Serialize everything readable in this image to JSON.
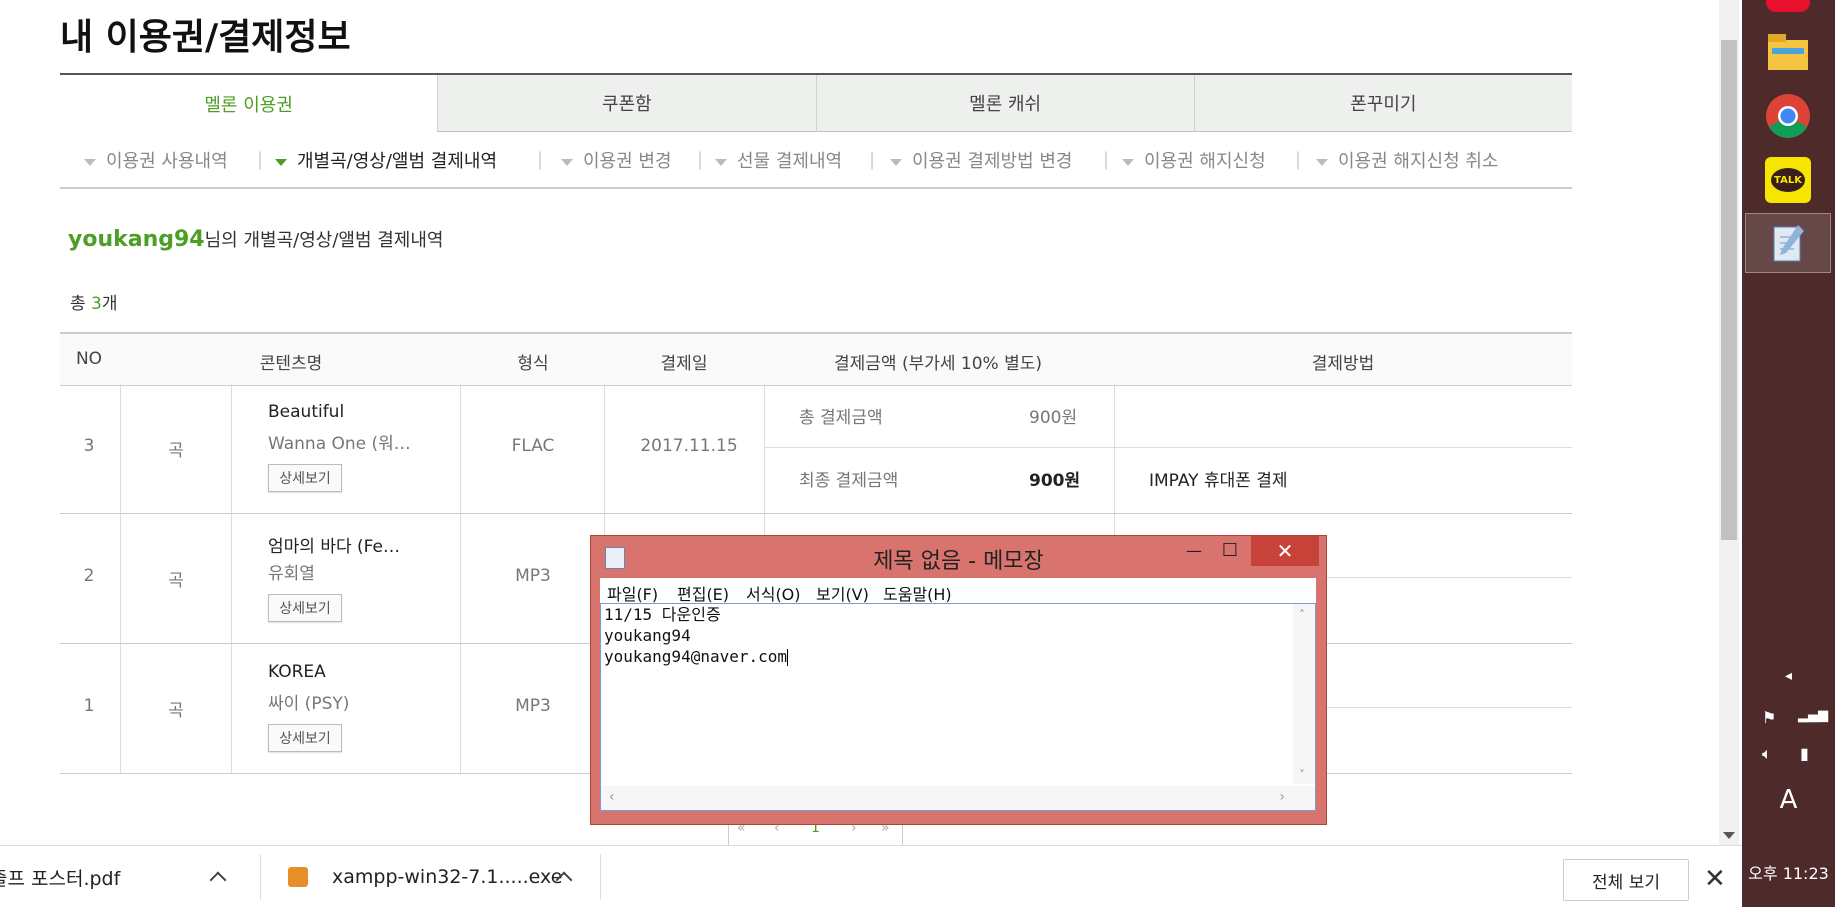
{
  "page": {
    "title": "내 이용권/결제정보",
    "tabs": [
      "멜론 이용권",
      "쿠폰함",
      "멜론 캐쉬",
      "폰꾸미기"
    ],
    "subnav": [
      "이용권 사용내역",
      "개별곡/영상/앨범 결제내역",
      "이용권 변경",
      "선물 결제내역",
      "이용권 결제방법 변경",
      "이용권 해지신청",
      "이용권 해지신청 취소"
    ],
    "username": "youkang94",
    "user_suffix": "님의 개별곡/영상/앨범 결제내역",
    "count_prefix": "총 ",
    "count_value": "3",
    "count_suffix": "개",
    "table": {
      "headers": [
        "NO",
        "콘텐츠명",
        "형식",
        "결제일",
        "결제금액 (부가세 10% 별도)",
        "결제방법"
      ],
      "rows": [
        {
          "no": "3",
          "type": "곡",
          "title": "Beautiful",
          "artist": "Wanna One (워…",
          "detail": "상세보기",
          "format": "FLAC",
          "date": "2017.11.15",
          "total_label": "총 결제금액",
          "total_amount": "900원",
          "final_label": "최종 결제금액",
          "final_amount": "900원",
          "method": "IMPAY 휴대폰 결제"
        },
        {
          "no": "2",
          "type": "곡",
          "title": "엄마의 바다 (Fe…",
          "artist": "유회열",
          "detail": "상세보기",
          "format": "MP3"
        },
        {
          "no": "1",
          "type": "곡",
          "title": "KOREA",
          "artist": "싸이 (PSY)",
          "detail": "상세보기",
          "format": "MP3"
        }
      ]
    },
    "pager": {
      "first": "«",
      "prev": "‹",
      "current": "1",
      "next": "›",
      "last": "»"
    }
  },
  "notepad": {
    "title": "제목 없음 - 메모장",
    "minimize": "—",
    "maximize": "☐",
    "close": "✕",
    "menu": [
      "파일(F)",
      "편집(E)",
      "서식(O)",
      "보기(V)",
      "도움말(H)"
    ],
    "lines": [
      "11/15 다운인증",
      "youkang94",
      "youkang94@naver.com"
    ]
  },
  "downloads": {
    "items": [
      "줄프 포스터.pdf",
      "xampp-win32-7.1.....exe"
    ],
    "show_all": "전체 보기",
    "close": "✕"
  },
  "taskbar": {
    "apps": [
      "file-explorer",
      "chrome",
      "kakaotalk",
      "notepad"
    ],
    "kakao_label": "TALK",
    "ime": "A",
    "clock": "오후 11:23"
  },
  "colors": {
    "accent": "#4d9e25",
    "notepad_frame": "#d8746d",
    "notepad_close": "#c7433a",
    "taskbar": "#4f2a2a"
  }
}
